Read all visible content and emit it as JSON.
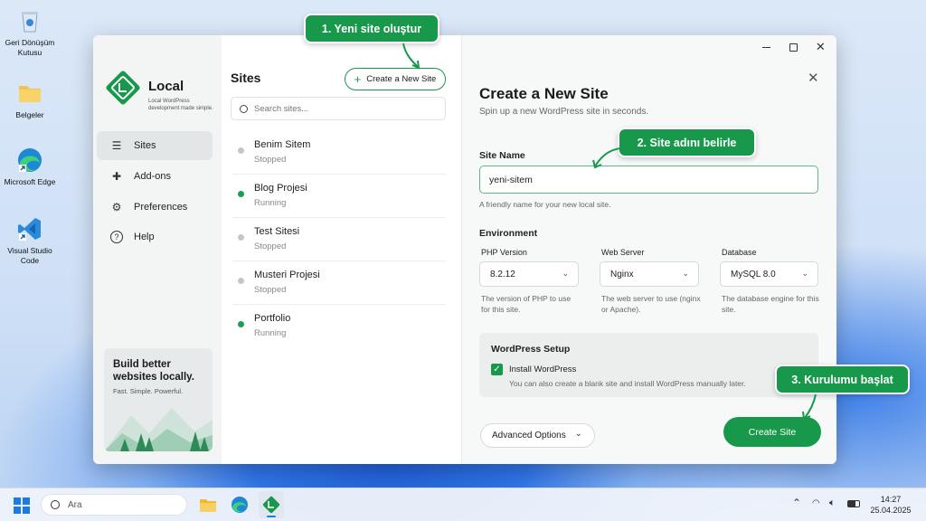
{
  "desktop": {
    "icons": [
      {
        "name": "recycle-bin",
        "label": "Geri Dönüşüm Kutusu"
      },
      {
        "name": "folder",
        "label": "Belgeler"
      },
      {
        "name": "edge",
        "label": "Microsoft Edge"
      },
      {
        "name": "vscode",
        "label": "Visual Studio Code"
      }
    ]
  },
  "app": {
    "brand": "Local",
    "tagline": "Local WordPress development made simple.",
    "nav": [
      {
        "label": "Sites",
        "icon": "sites-icon",
        "active": true
      },
      {
        "label": "Add-ons",
        "icon": "puzzle-icon",
        "active": false
      },
      {
        "label": "Preferences",
        "icon": "sliders-icon",
        "active": false
      },
      {
        "label": "Help",
        "icon": "help-icon",
        "active": false
      }
    ],
    "promo": {
      "title": "Build better websites locally.",
      "subtitle": "Fast. Simple. Powerful."
    }
  },
  "sites_panel": {
    "title": "Sites",
    "create_button": "Create a New Site",
    "search_placeholder": "Search sites...",
    "sites": [
      {
        "name": "Benim Sitem",
        "status": "Stopped"
      },
      {
        "name": "Blog Projesi",
        "status": "Running"
      },
      {
        "name": "Test Sitesi",
        "status": "Stopped"
      },
      {
        "name": "Musteri Projesi",
        "status": "Stopped"
      },
      {
        "name": "Portfolio",
        "status": "Running"
      }
    ]
  },
  "create_form": {
    "title": "Create a New Site",
    "subtitle": "Spin up a new WordPress site in seconds.",
    "site_name_label": "Site Name",
    "site_name_value": "yeni-sitem",
    "site_name_help": "A friendly name for your new local site.",
    "environment_label": "Environment",
    "php": {
      "label": "PHP Version",
      "value": "8.2.12",
      "help": "The version of PHP to use for this site."
    },
    "webserver": {
      "label": "Web Server",
      "value": "Nginx",
      "help": "The web server to use (nginx or Apache)."
    },
    "database": {
      "label": "Database",
      "value": "MySQL 8.0",
      "help": "The database engine for this site."
    },
    "wp_setup": {
      "title": "WordPress Setup",
      "checkbox_label": "Install WordPress",
      "checked": true,
      "help": "You can also create a blank site and install WordPress manually later."
    },
    "advanced_button": "Advanced Options",
    "create_button": "Create Site"
  },
  "callouts": {
    "step1": "1. Yeni site oluştur",
    "step2": "2. Site adını belirle",
    "step3": "3. Kurulumu başlat"
  },
  "taskbar": {
    "search_placeholder": "Ara",
    "time": "14:27",
    "date": "25.04.2025"
  },
  "colors": {
    "accent": "#17984b",
    "running": "#1e9e50",
    "stopped": "#c3c7c7"
  }
}
